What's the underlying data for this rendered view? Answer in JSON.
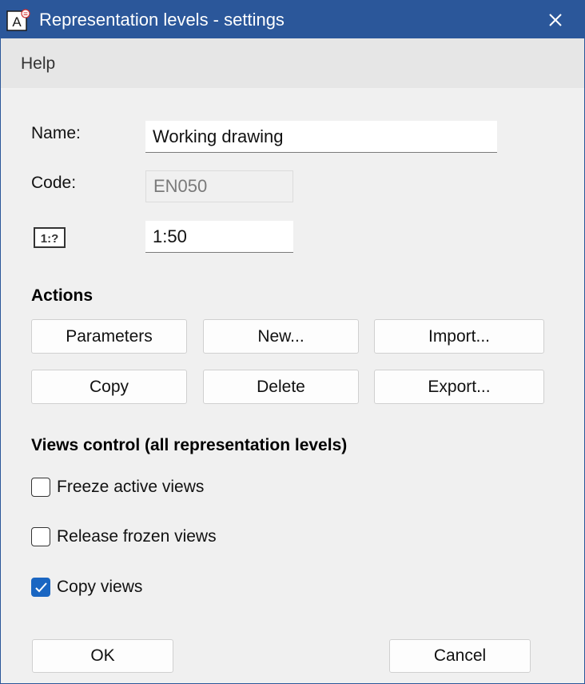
{
  "window": {
    "title": "Representation levels - settings",
    "app_icon": "allplan-icon",
    "close_icon": "close-icon"
  },
  "menu": {
    "items": [
      {
        "label": "Help"
      }
    ]
  },
  "form": {
    "name_label": "Name:",
    "name_value": "Working drawing",
    "code_label": "Code:",
    "code_value": "EN050",
    "scale_icon": "scale-icon",
    "scale_icon_text": "1:?",
    "scale_value": "1:50"
  },
  "actions": {
    "title": "Actions",
    "buttons": [
      {
        "label": "Parameters"
      },
      {
        "label": "New..."
      },
      {
        "label": "Import..."
      },
      {
        "label": "Copy"
      },
      {
        "label": "Delete"
      },
      {
        "label": "Export..."
      }
    ]
  },
  "views_control": {
    "title": "Views control (all representation levels)",
    "options": [
      {
        "label": "Freeze active views",
        "checked": false
      },
      {
        "label": "Release frozen views",
        "checked": false
      },
      {
        "label": "Copy views",
        "checked": true
      }
    ]
  },
  "footer": {
    "ok_label": "OK",
    "cancel_label": "Cancel"
  },
  "colors": {
    "titlebar": "#2b579a",
    "accent": "#1a66c2",
    "background": "#f0f0f0"
  }
}
